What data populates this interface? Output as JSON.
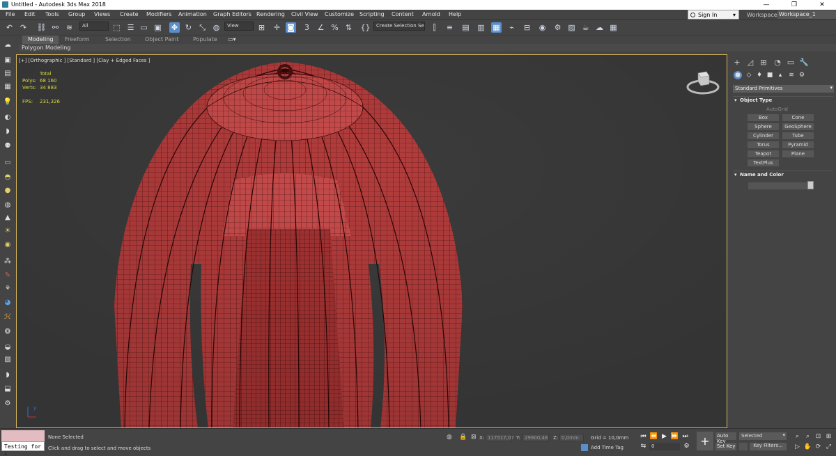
{
  "window": {
    "title": "Untitled - Autodesk 3ds Max 2018",
    "minimize": "—",
    "maximize": "❐",
    "close": "✕"
  },
  "menu": [
    "File",
    "Edit",
    "Tools",
    "Group",
    "Views",
    "Create",
    "Modifiers",
    "Animation",
    "Graph Editors",
    "Rendering",
    "Civil View",
    "Customize",
    "Scripting",
    "Content",
    "Arnold",
    "Help"
  ],
  "account": {
    "signin": "Sign In",
    "workspaces_label": "Workspaces:",
    "workspace": "Workspace_1"
  },
  "toolbar": {
    "filter": "All",
    "refcoord": "View",
    "selection_set": "Create Selection Se",
    "angle_snap": "3",
    "percent_snap": "%",
    "spinner_snap": "%"
  },
  "ribbon": {
    "tabs": [
      "Modeling",
      "Freeform",
      "Selection",
      "Object Paint",
      "Populate"
    ],
    "active": "Modeling",
    "subtitle": "Polygon Modeling"
  },
  "viewport": {
    "label": "[+] [Orthographic ] [Standard ] [Clay + Edged Faces ]",
    "stats": {
      "total_label": "Total",
      "polys_label": "Polys:",
      "polys": "68 160",
      "verts_label": "Verts:",
      "verts": "34 883",
      "fps_label": "FPS:",
      "fps": "231,326"
    },
    "axis_label": "y",
    "colors": {
      "mesh": "#b04040",
      "wire": "#3a0a0a",
      "border": "#d6b75b"
    }
  },
  "command_panel": {
    "primitives_dropdown": "Standard Primitives",
    "object_type_title": "Object Type",
    "autogrid": "AutoGrid",
    "buttons": [
      "Box",
      "Cone",
      "Sphere",
      "GeoSphere",
      "Cylinder",
      "Tube",
      "Torus",
      "Pyramid",
      "Teapot",
      "Plane",
      "TextPlus"
    ],
    "name_color_title": "Name and Color"
  },
  "status": {
    "script_input": "Testing for ;",
    "selection": "None Selected",
    "prompt": "Click and drag to select and move objects",
    "x_label": "X:",
    "x": "117517,07",
    "y_label": "Y:",
    "y": "29900,48",
    "z_label": "Z:",
    "z": "0,0mm",
    "grid": "Grid = 10,0mm",
    "add_time_tag": "Add Time Tag",
    "frame": "0",
    "auto_key": "Auto Key",
    "set_key": "Set Key",
    "key_mode": "Selected",
    "key_filters": "Key Filters..."
  }
}
